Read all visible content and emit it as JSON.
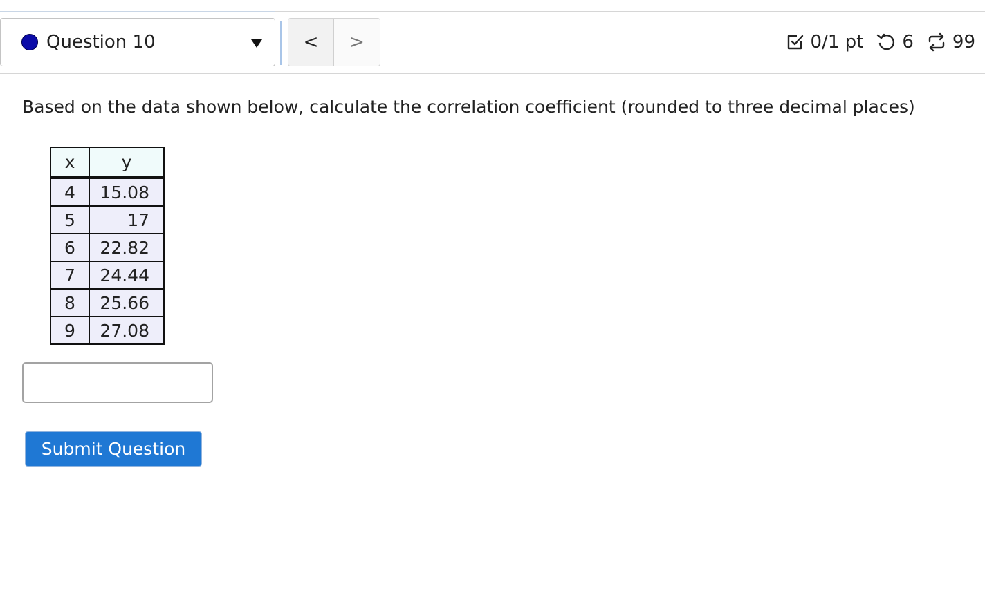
{
  "header": {
    "question_label": "Question 10",
    "status_color": "#0b0ba8",
    "nav": {
      "prev_label": "<",
      "next_label": ">"
    },
    "stats": {
      "score": "0/1 pt",
      "retries": "6",
      "attempts": "99",
      "score_icon": "checkbox-icon",
      "retry_icon": "undo-icon",
      "attempts_icon": "repeat-icon"
    }
  },
  "question": {
    "prompt": "Based on the data shown below, calculate the correlation coefficient (rounded to three decimal places)",
    "table": {
      "headers": [
        "x",
        "y"
      ],
      "rows": [
        [
          "4",
          "15.08"
        ],
        [
          "5",
          "17"
        ],
        [
          "6",
          "22.82"
        ],
        [
          "7",
          "24.44"
        ],
        [
          "8",
          "25.66"
        ],
        [
          "9",
          "27.08"
        ]
      ]
    },
    "answer_value": "",
    "submit_label": "Submit Question"
  },
  "colors": {
    "accent": "#1f78d4"
  }
}
